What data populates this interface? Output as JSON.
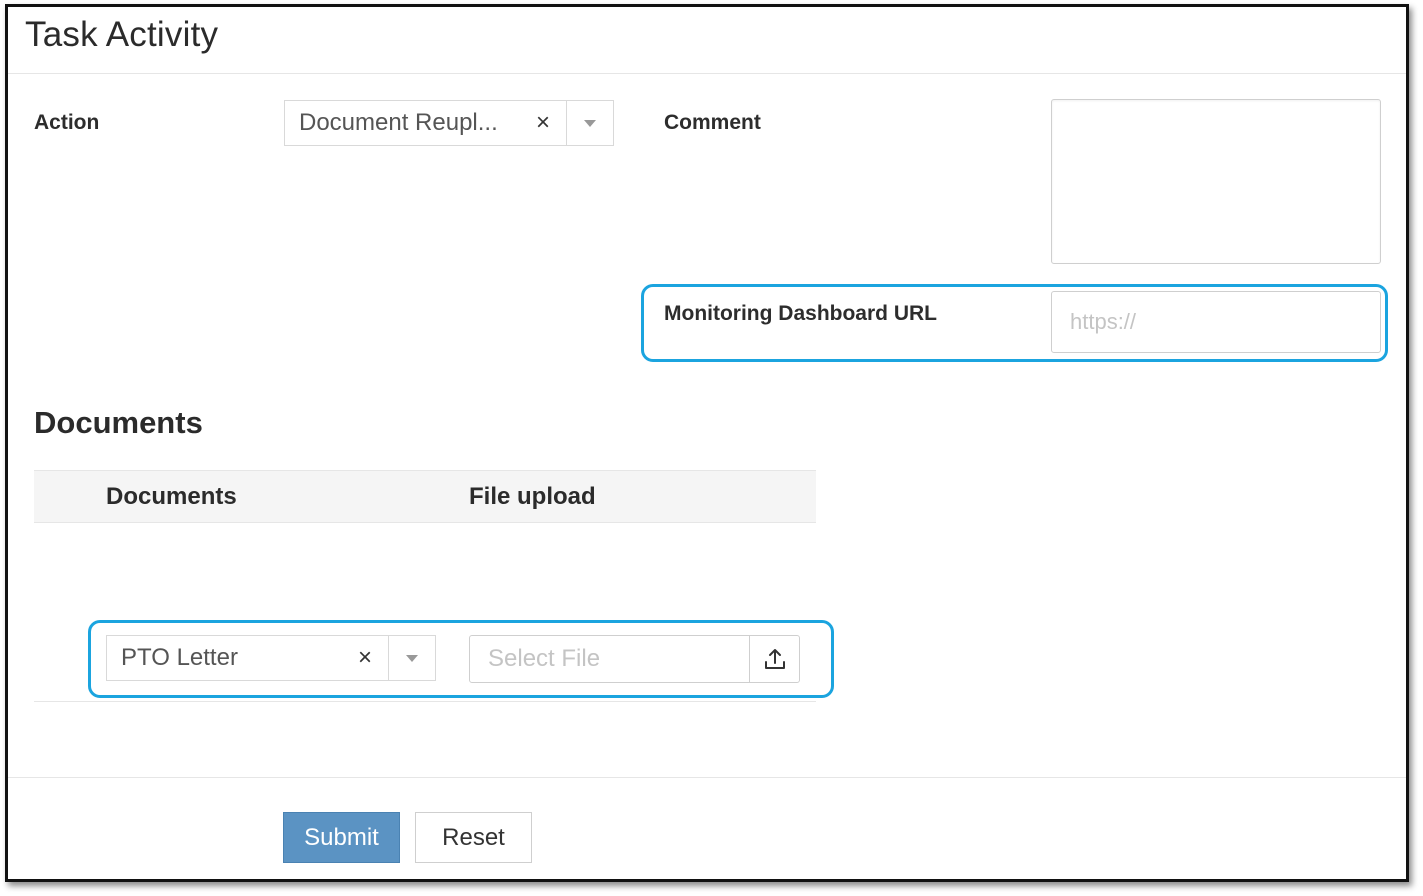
{
  "page": {
    "title": "Task Activity"
  },
  "form": {
    "action_label": "Action",
    "action_value": "Document Reupl...",
    "clear_glyph": "×",
    "comment_label": "Comment",
    "comment_value": "",
    "url_label": "Monitoring Dashboard URL",
    "url_placeholder": "https://"
  },
  "documents": {
    "section_title": "Documents",
    "columns": [
      "Documents",
      "File upload"
    ],
    "rows": [
      {
        "document": "PTO Letter",
        "file_placeholder": "Select File"
      }
    ]
  },
  "buttons": {
    "submit": "Submit",
    "reset": "Reset"
  },
  "colors": {
    "highlight": "#1ba4df",
    "primary": "#5b93c3"
  },
  "icons": {
    "clear": "close-icon",
    "dropdown": "chevron-down-icon",
    "upload": "upload-icon"
  }
}
